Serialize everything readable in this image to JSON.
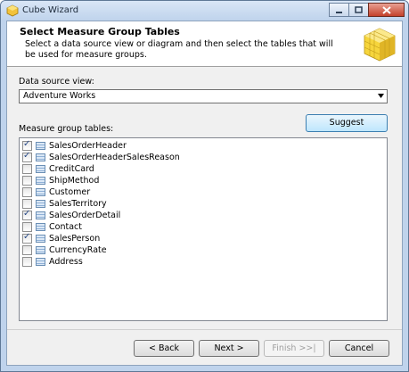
{
  "window": {
    "title": "Cube Wizard"
  },
  "header": {
    "title": "Select Measure Group Tables",
    "description": "Select a data source view or diagram and then select the tables that will be used for measure groups."
  },
  "data_source": {
    "label": "Data source view:",
    "value": "Adventure Works"
  },
  "tables": {
    "label": "Measure group tables:",
    "suggest_label": "Suggest",
    "items": [
      {
        "name": "SalesOrderHeader",
        "checked": true
      },
      {
        "name": "SalesOrderHeaderSalesReason",
        "checked": true
      },
      {
        "name": "CreditCard",
        "checked": false
      },
      {
        "name": "ShipMethod",
        "checked": false
      },
      {
        "name": "Customer",
        "checked": false
      },
      {
        "name": "SalesTerritory",
        "checked": false
      },
      {
        "name": "SalesOrderDetail",
        "checked": true
      },
      {
        "name": "Contact",
        "checked": false
      },
      {
        "name": "SalesPerson",
        "checked": true
      },
      {
        "name": "CurrencyRate",
        "checked": false
      },
      {
        "name": "Address",
        "checked": false
      }
    ]
  },
  "buttons": {
    "back": "< Back",
    "next": "Next >",
    "finish": "Finish >>|",
    "cancel": "Cancel"
  }
}
